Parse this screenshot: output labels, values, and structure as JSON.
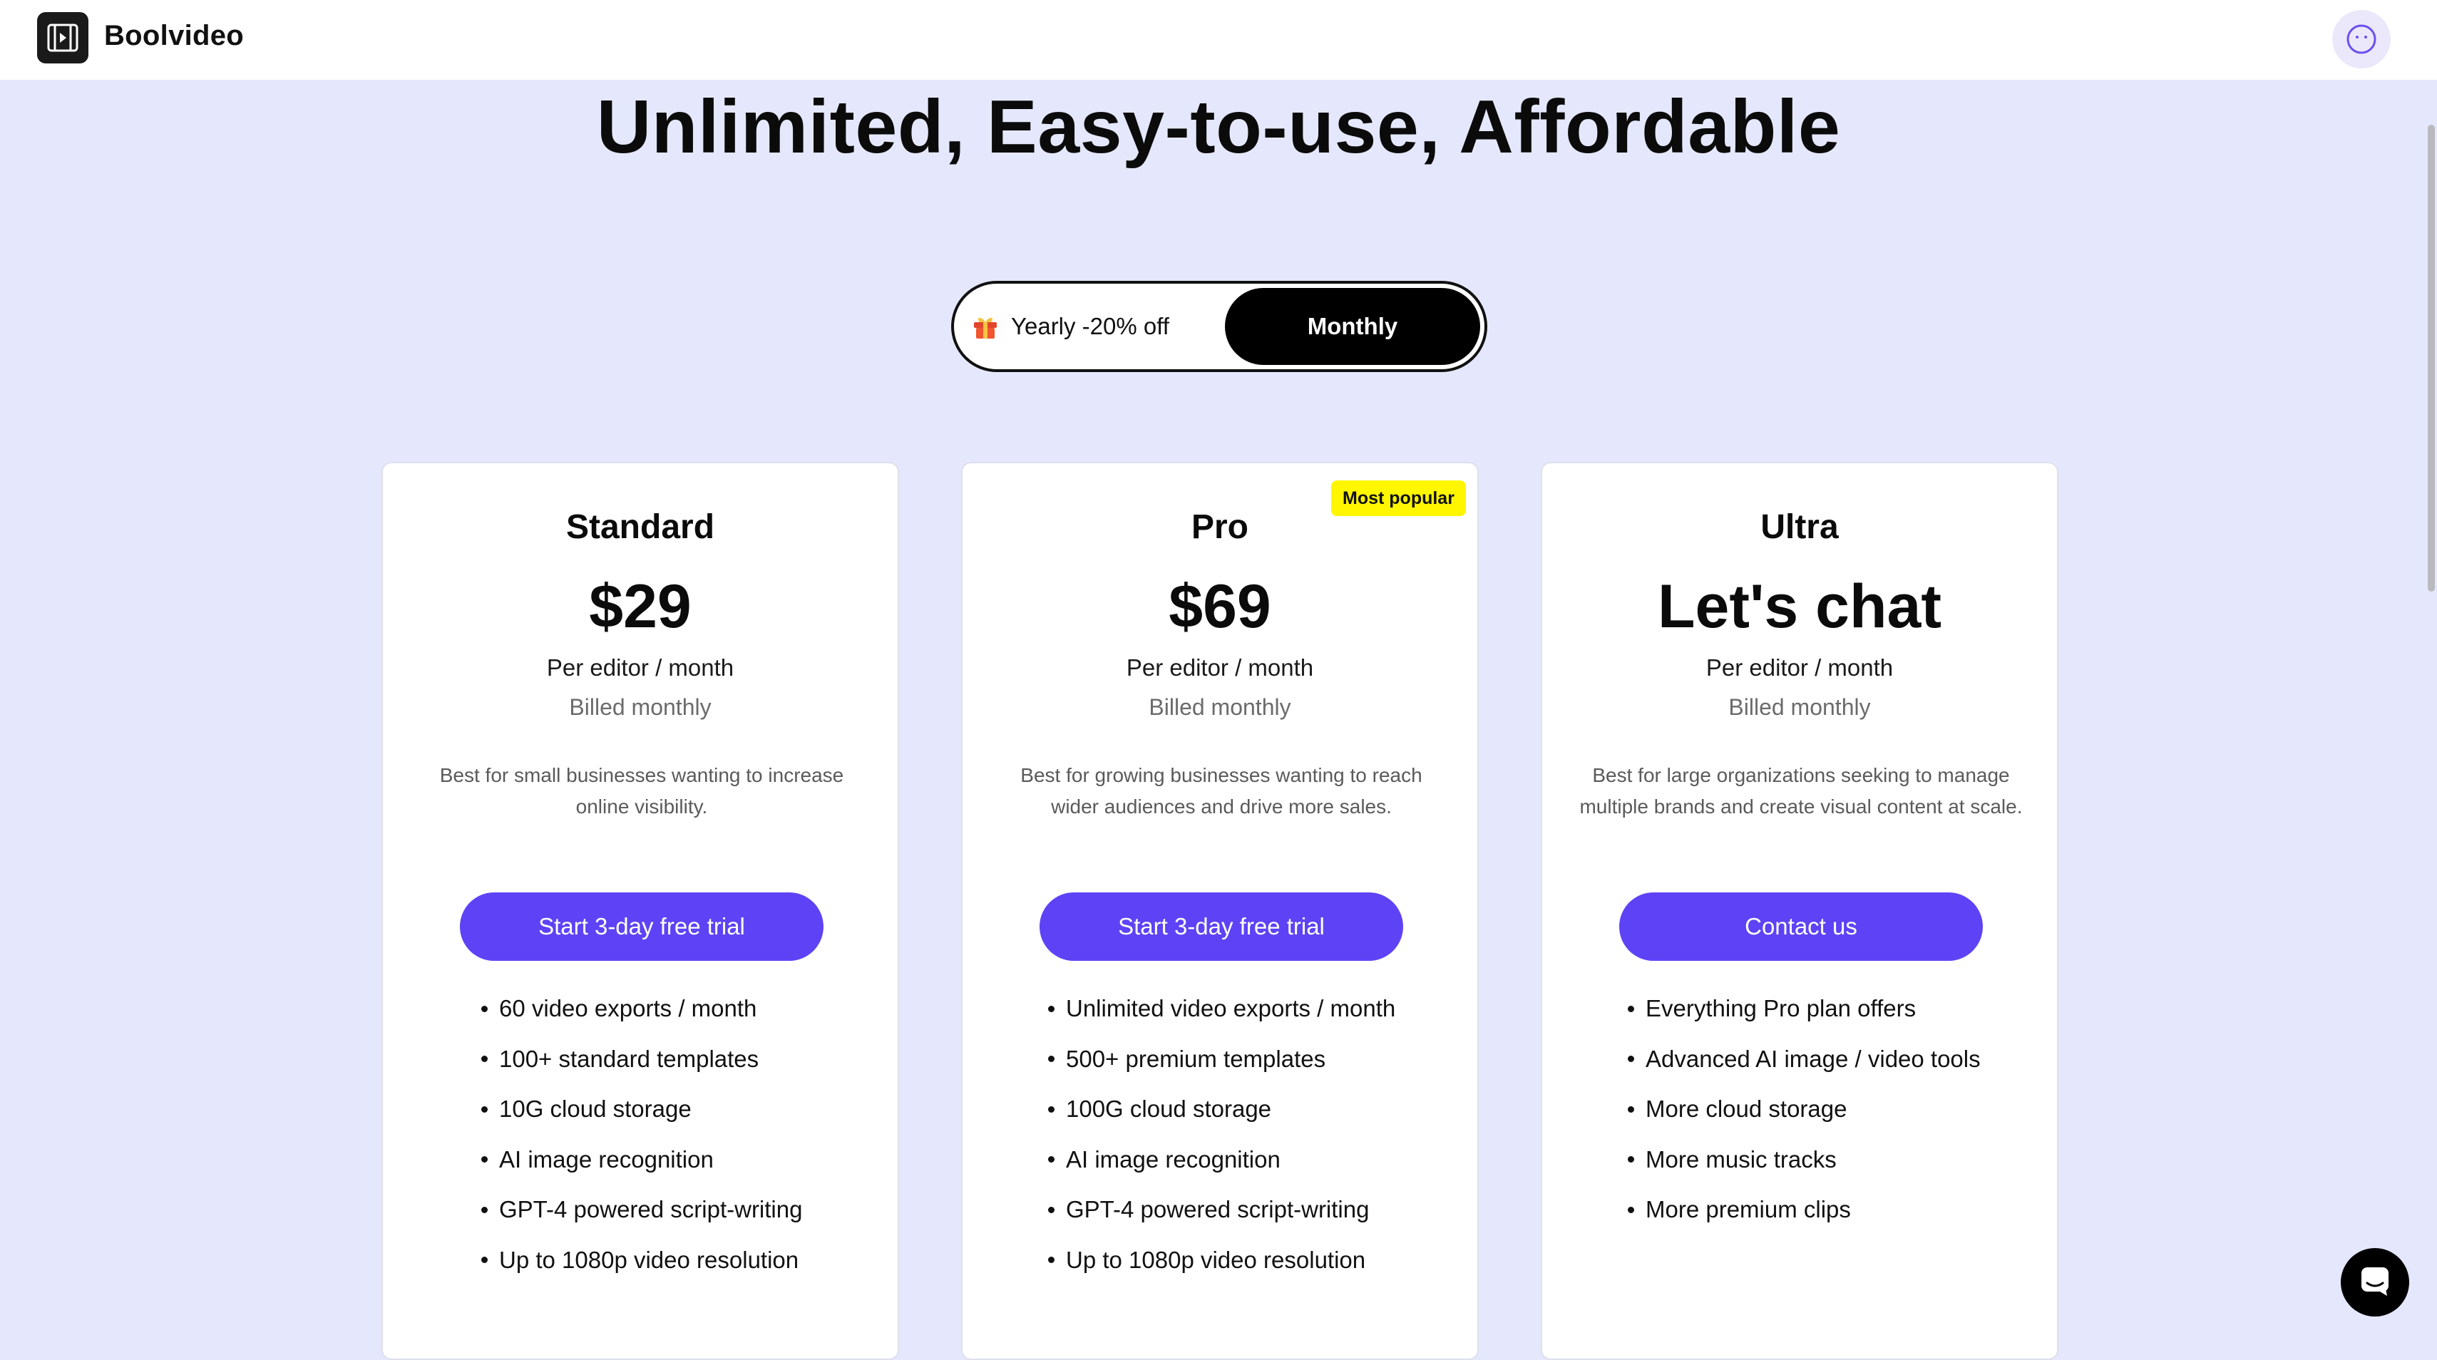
{
  "header": {
    "brand": "Boolvideo",
    "logo_icon": "film-frame-icon",
    "avatar_icon": "user-avatar-icon"
  },
  "headline": "Unlimited, Easy-to-use, Affordable",
  "billing_toggle": {
    "yearly_label": "Yearly -20% off",
    "yearly_icon": "gift-icon",
    "monthly_label": "Monthly",
    "selected": "Monthly"
  },
  "plans": [
    {
      "title": "Standard",
      "price": "$29",
      "unit": "Per editor / month",
      "billing": "Billed monthly",
      "description": "Best for small businesses wanting to increase online visibility.",
      "cta": "Start 3-day free trial",
      "features": [
        "60 video exports / month",
        "100+ standard templates",
        "10G cloud storage",
        "AI image recognition",
        "GPT-4 powered script-writing",
        "Up to 1080p video resolution"
      ]
    },
    {
      "title": "Pro",
      "badge": "Most popular",
      "price": "$69",
      "unit": "Per editor / month",
      "billing": "Billed monthly",
      "description": "Best for growing businesses wanting to reach wider audiences and drive more sales.",
      "cta": "Start 3-day free trial",
      "features": [
        "Unlimited video exports / month",
        "500+ premium templates",
        "100G cloud storage",
        "AI image recognition",
        "GPT-4 powered script-writing",
        "Up to 1080p video resolution"
      ]
    },
    {
      "title": "Ultra",
      "price": "Let's chat",
      "unit": "Per editor / month",
      "billing": "Billed monthly",
      "description": "Best for large organizations seeking to manage multiple brands and create visual content at scale.",
      "cta": "Contact us",
      "features": [
        "Everything Pro plan offers",
        "Advanced AI image / video tools",
        "More cloud storage",
        "More music tracks",
        "More premium clips"
      ]
    }
  ],
  "chat_widget": {
    "icon": "chat-bubble-icon"
  },
  "colors": {
    "background": "#e5e8fc",
    "accent": "#5d43f5",
    "badge": "#fff600"
  }
}
